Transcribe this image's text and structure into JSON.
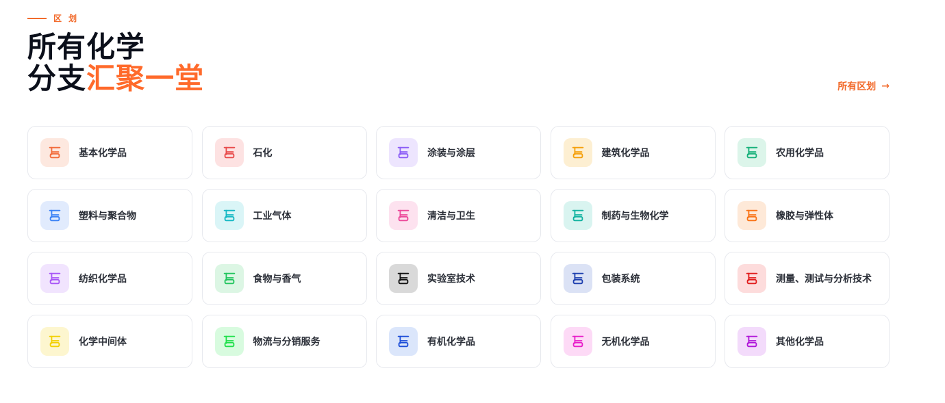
{
  "section": {
    "eyebrow": "区 划",
    "title_line1": "所有化学",
    "title_line2_prefix": "分支",
    "title_line2_accent": "汇聚一堂",
    "all_link_label": "所有区划",
    "all_link_arrow": "→"
  },
  "categories": [
    {
      "label": "基本化学品",
      "color": "#f26b3a",
      "bg": "#fde8df"
    },
    {
      "label": "石化",
      "color": "#e84a4a",
      "bg": "#fde2e2"
    },
    {
      "label": "涂装与涂层",
      "color": "#8b5cf6",
      "bg": "#ede5fe"
    },
    {
      "label": "建筑化学品",
      "color": "#f5a00b",
      "bg": "#fdefd2"
    },
    {
      "label": "农用化学品",
      "color": "#16b17a",
      "bg": "#dcf5ea"
    },
    {
      "label": "塑料与聚合物",
      "color": "#3b82f6",
      "bg": "#e1ebfd"
    },
    {
      "label": "工业气体",
      "color": "#14b8c4",
      "bg": "#daf5f7"
    },
    {
      "label": "清洁与卫生",
      "color": "#ec4899",
      "bg": "#fde2ef"
    },
    {
      "label": "制药与生物化学",
      "color": "#12b3a0",
      "bg": "#d9f4f0"
    },
    {
      "label": "橡胶与弹性体",
      "color": "#f97316",
      "bg": "#fee9d8"
    },
    {
      "label": "纺织化学品",
      "color": "#a855f7",
      "bg": "#f1e4fe"
    },
    {
      "label": "食物与香气",
      "color": "#22c55e",
      "bg": "#dcf6e4"
    },
    {
      "label": "实验室技术",
      "color": "#111111",
      "bg": "#d9d9d9"
    },
    {
      "label": "包装系统",
      "color": "#1e40af",
      "bg": "#dbe2f5"
    },
    {
      "label": "测量、测试与分析技术",
      "color": "#e11d1d",
      "bg": "#fddcdc"
    },
    {
      "label": "化学中间体",
      "color": "#f2d000",
      "bg": "#fdf6cf"
    },
    {
      "label": "物流与分销服务",
      "color": "#1ee04a",
      "bg": "#d8fbdf"
    },
    {
      "label": "有机化学品",
      "color": "#1d4ed8",
      "bg": "#dbe6fb"
    },
    {
      "label": "无机化学品",
      "color": "#e81ec9",
      "bg": "#fddaf6"
    },
    {
      "label": "其他化学品",
      "color": "#b016d9",
      "bg": "#f3dbfb"
    }
  ]
}
